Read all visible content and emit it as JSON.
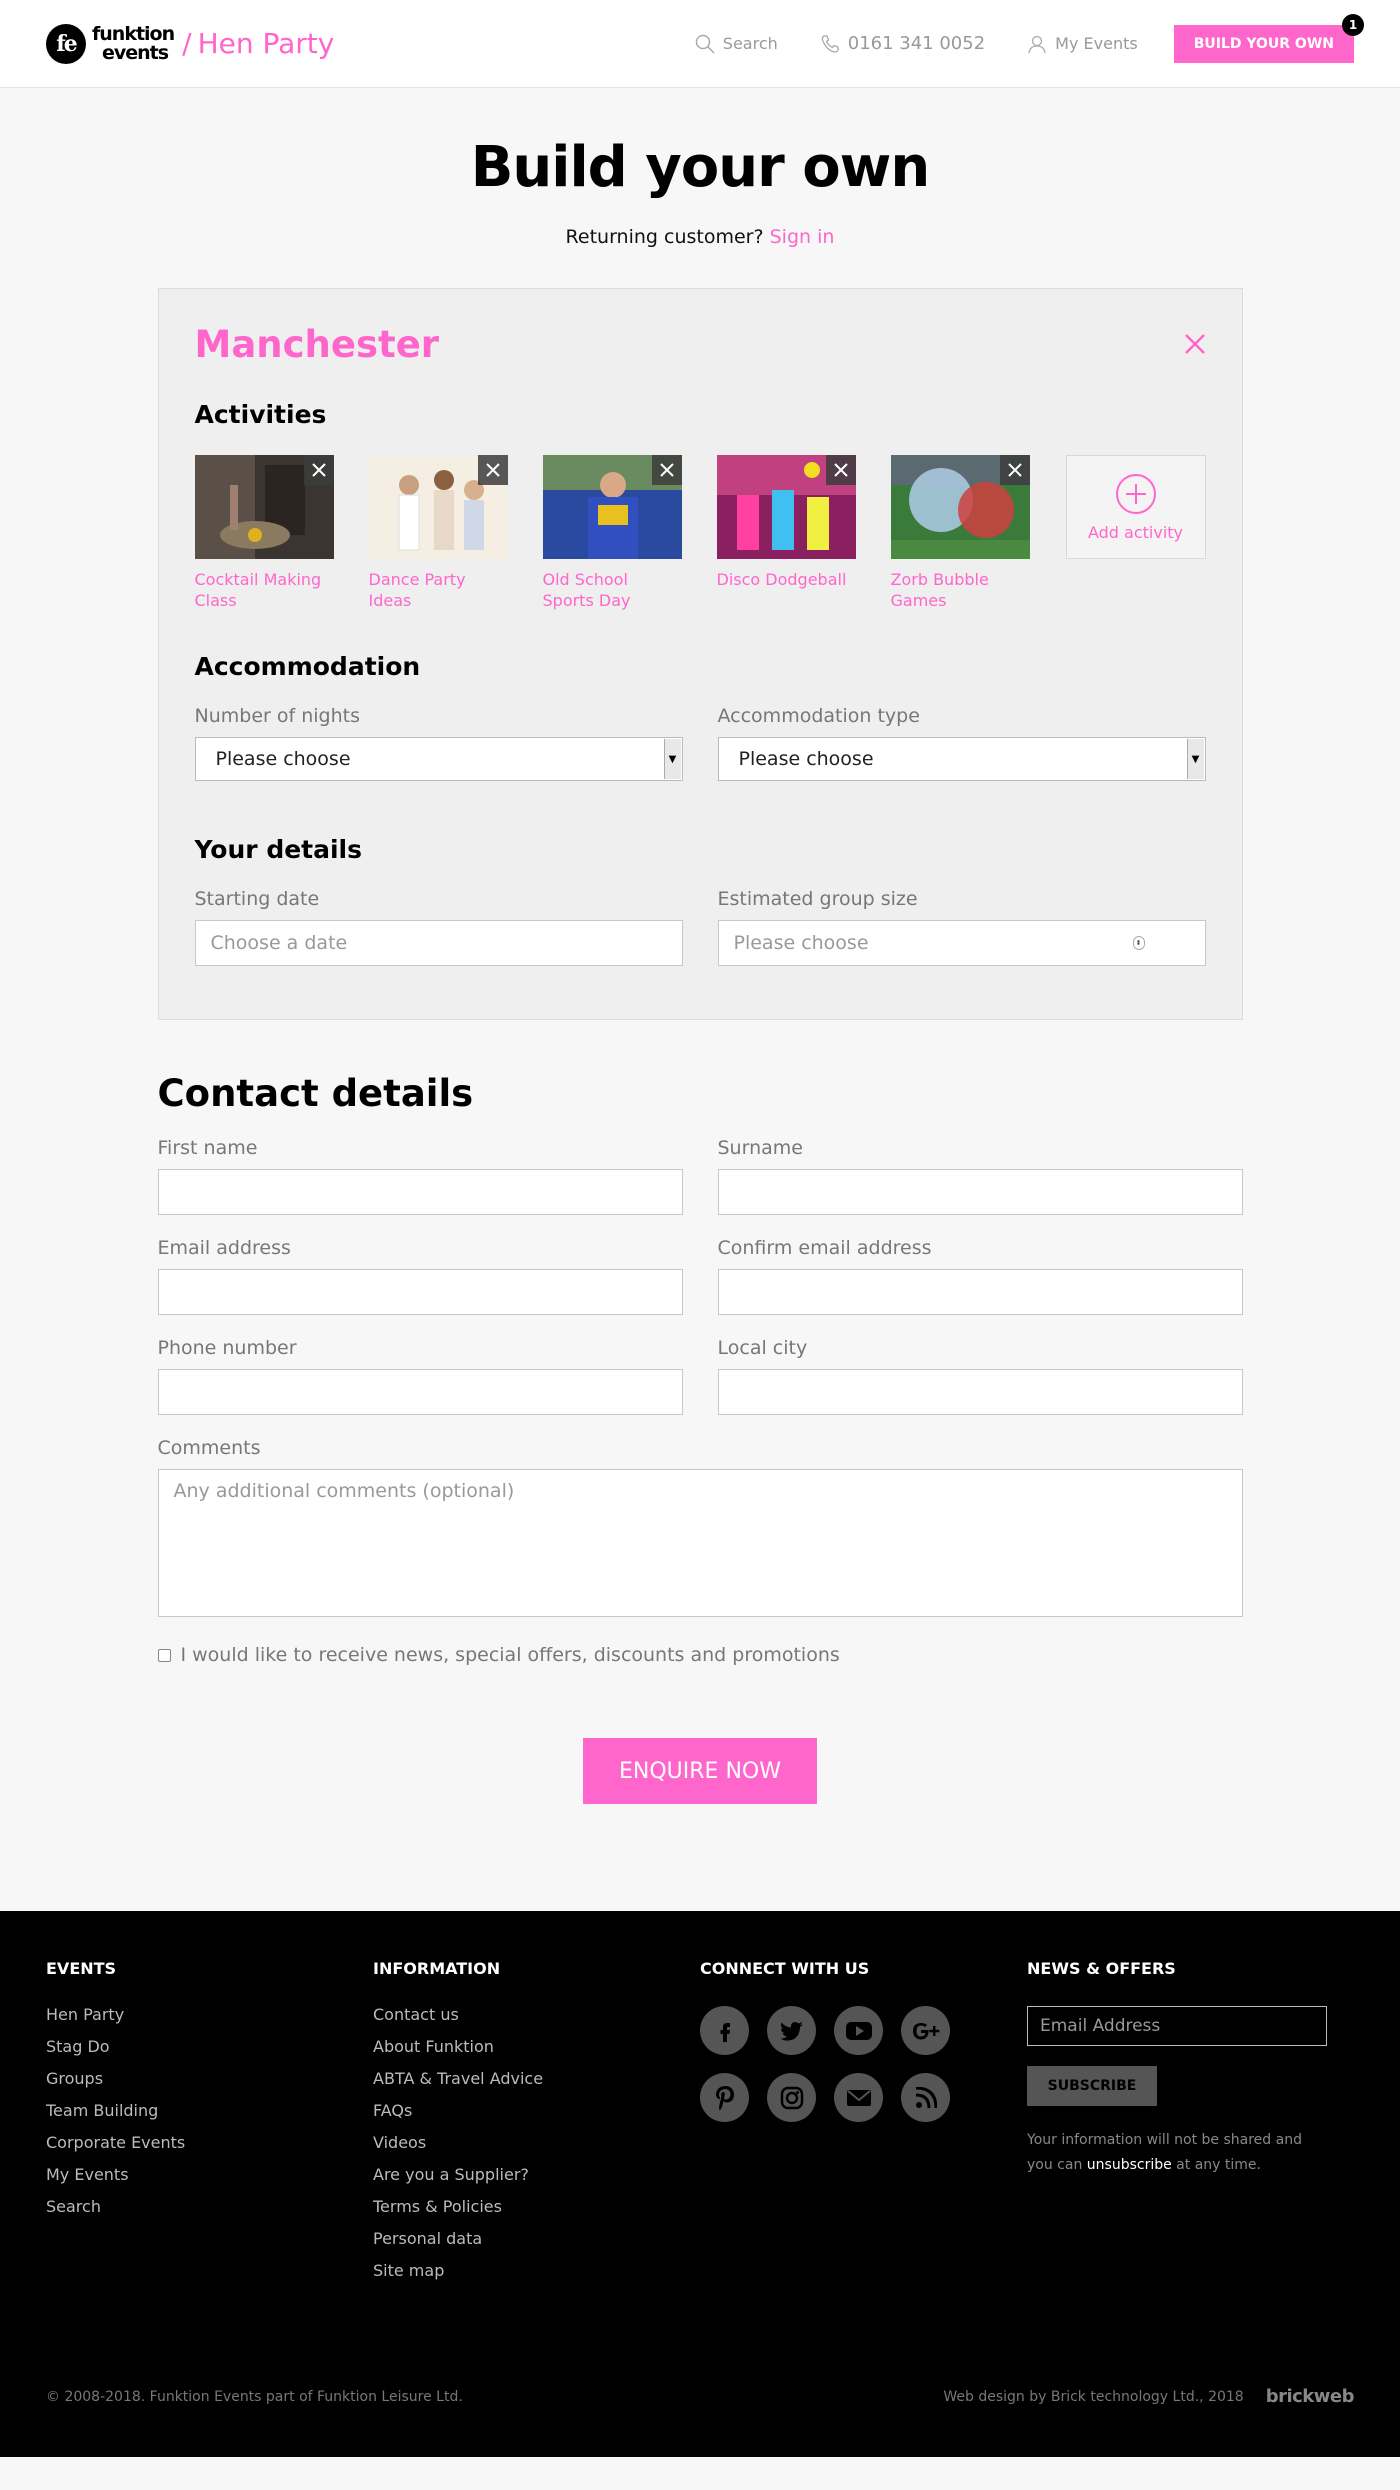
{
  "header": {
    "logo_mark": "fe",
    "logo_line1": "funktion",
    "logo_line2": "events",
    "section_sep": "/",
    "section": "Hen Party",
    "search_label": "Search",
    "phone": "0161 341 0052",
    "my_events": "My Events",
    "build_button": "BUILD YOUR OWN",
    "build_count": "1"
  },
  "page": {
    "title": "Build your own",
    "returning_text": "Returning customer?",
    "sign_in": "Sign in"
  },
  "builder": {
    "city": "Manchester",
    "activities_title": "Activities",
    "activities": [
      {
        "label": "Cocktail Making Class"
      },
      {
        "label": "Dance Party Ideas"
      },
      {
        "label": "Old School Sports Day"
      },
      {
        "label": "Disco Dodgeball"
      },
      {
        "label": "Zorb Bubble Games"
      }
    ],
    "add_activity": "Add activity",
    "accommodation_title": "Accommodation",
    "nights_label": "Number of nights",
    "nights_value": "Please choose",
    "accom_type_label": "Accommodation type",
    "accom_type_value": "Please choose",
    "details_title": "Your details",
    "start_date_label": "Starting date",
    "start_date_placeholder": "Choose a date",
    "group_size_label": "Estimated group size",
    "group_size_placeholder": "Please choose"
  },
  "contact": {
    "title": "Contact details",
    "first_name": "First name",
    "surname": "Surname",
    "email": "Email address",
    "confirm_email": "Confirm email address",
    "phone": "Phone number",
    "city": "Local city",
    "comments": "Comments",
    "comments_placeholder": "Any additional comments (optional)",
    "consent": "I would like to receive news, special offers, discounts and promotions",
    "enquire": "ENQUIRE NOW"
  },
  "footer": {
    "events_head": "EVENTS",
    "events": [
      "Hen Party",
      "Stag Do",
      "Groups",
      "Team Building",
      "Corporate Events",
      "My Events",
      "Search"
    ],
    "info_head": "INFORMATION",
    "info": [
      "Contact us",
      "About Funktion",
      "ABTA & Travel Advice",
      "FAQs",
      "Videos",
      "Are you a Supplier?",
      "Terms & Policies",
      "Personal data",
      "Site map"
    ],
    "connect_head": "CONNECT WITH US",
    "social_icons": [
      "facebook-icon",
      "twitter-icon",
      "youtube-icon",
      "google-plus-icon",
      "pinterest-icon",
      "instagram-icon",
      "email-icon",
      "rss-icon"
    ],
    "news_head": "NEWS & OFFERS",
    "email_placeholder": "Email Address",
    "subscribe": "SUBSCRIBE",
    "privacy_pre": "Your information will not be shared and you can",
    "privacy_link": "unsubscribe",
    "privacy_post": "at any time.",
    "copyright": "© 2008-2018. Funktion Events part of Funktion Leisure Ltd.",
    "credit": "Web design by Brick technology Ltd., 2018",
    "credit_brand": "brickweb"
  },
  "colors": {
    "accent": "#ff66cc",
    "footer_bg": "#000000",
    "panel_bg": "#efefef"
  }
}
